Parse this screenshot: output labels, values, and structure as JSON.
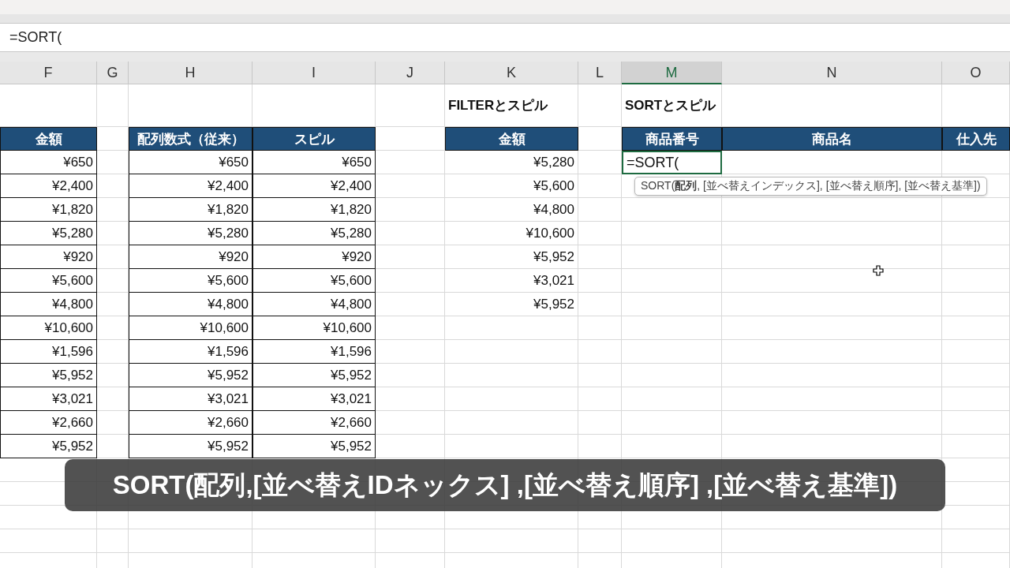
{
  "formula_bar": {
    "value": "=SORT("
  },
  "columns": [
    {
      "letter": "F",
      "selected": false,
      "boxed": true
    },
    {
      "letter": "G",
      "selected": false,
      "boxed": false
    },
    {
      "letter": "H",
      "selected": false,
      "boxed": true
    },
    {
      "letter": "I",
      "selected": false,
      "boxed": true
    },
    {
      "letter": "J",
      "selected": false,
      "boxed": false
    },
    {
      "letter": "K",
      "selected": false,
      "boxed": false
    },
    {
      "letter": "L",
      "selected": false,
      "boxed": false
    },
    {
      "letter": "M",
      "selected": true,
      "boxed": false
    },
    {
      "letter": "N",
      "selected": false,
      "boxed": false
    },
    {
      "letter": "O",
      "selected": false,
      "boxed": false
    }
  ],
  "rows": [
    {
      "kind": "title",
      "active": false,
      "cells": {
        "K": "FILTERとスピル",
        "M": "SORTとスピル"
      }
    },
    {
      "kind": "header",
      "active": false,
      "cells": {
        "F": "金額",
        "H": "配列数式（従来）",
        "I": "スピル",
        "K": "金額",
        "M": "商品番号",
        "N": "商品名",
        "O": "仕入先"
      }
    },
    {
      "kind": "data",
      "active": true,
      "cells": {
        "F": "¥650",
        "H": "¥650",
        "I": "¥650",
        "K": "¥5,280",
        "M": "=SORT("
      }
    },
    {
      "kind": "data",
      "active": false,
      "cells": {
        "F": "¥2,400",
        "H": "¥2,400",
        "I": "¥2,400",
        "K": "¥5,600"
      }
    },
    {
      "kind": "data",
      "active": false,
      "cells": {
        "F": "¥1,820",
        "H": "¥1,820",
        "I": "¥1,820",
        "K": "¥4,800"
      }
    },
    {
      "kind": "data",
      "active": false,
      "cells": {
        "F": "¥5,280",
        "H": "¥5,280",
        "I": "¥5,280",
        "K": "¥10,600"
      }
    },
    {
      "kind": "data",
      "active": false,
      "cells": {
        "F": "¥920",
        "H": "¥920",
        "I": "¥920",
        "K": "¥5,952"
      }
    },
    {
      "kind": "data",
      "active": false,
      "cells": {
        "F": "¥5,600",
        "H": "¥5,600",
        "I": "¥5,600",
        "K": "¥3,021"
      }
    },
    {
      "kind": "data",
      "active": false,
      "cells": {
        "F": "¥4,800",
        "H": "¥4,800",
        "I": "¥4,800",
        "K": "¥5,952"
      }
    },
    {
      "kind": "data",
      "active": false,
      "cells": {
        "F": "¥10,600",
        "H": "¥10,600",
        "I": "¥10,600"
      }
    },
    {
      "kind": "data",
      "active": false,
      "cells": {
        "F": "¥1,596",
        "H": "¥1,596",
        "I": "¥1,596"
      }
    },
    {
      "kind": "data",
      "active": false,
      "cells": {
        "F": "¥5,952",
        "H": "¥5,952",
        "I": "¥5,952"
      }
    },
    {
      "kind": "data",
      "active": false,
      "cells": {
        "F": "¥3,021",
        "H": "¥3,021",
        "I": "¥3,021"
      }
    },
    {
      "kind": "data",
      "active": false,
      "cells": {
        "F": "¥2,660",
        "H": "¥2,660",
        "I": "¥2,660"
      }
    },
    {
      "kind": "data",
      "active": false,
      "cells": {
        "F": "¥5,952",
        "H": "¥5,952",
        "I": "¥5,952"
      }
    }
  ],
  "tooltip": "SORT(**配列**, [並べ替えインデックス], [並べ替え順序], [並べ替え基準])",
  "caption": "SORT(配列,[並べ替えIDネックス] ,[並べ替え順序] ,[並べ替え基準])"
}
